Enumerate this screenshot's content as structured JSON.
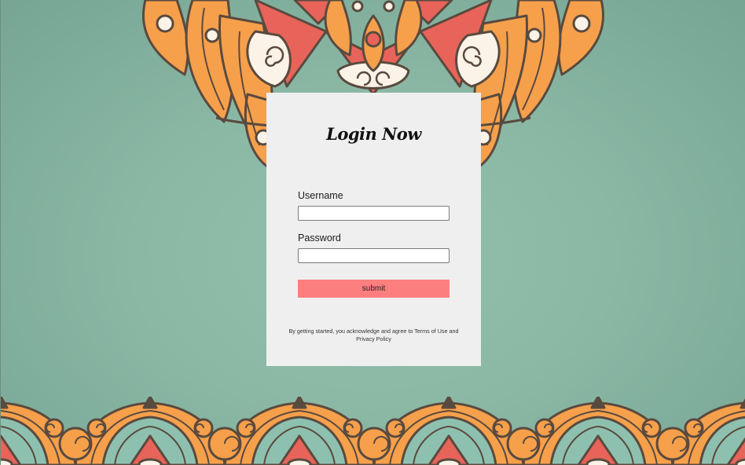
{
  "form": {
    "title": "Login Now",
    "username_label": "Username",
    "username_value": "",
    "password_label": "Password",
    "password_value": "",
    "submit_label": "submit",
    "terms_text": "By getting started, you acknowledge and agree to Terms of Use and Privacy Policy"
  },
  "colors": {
    "background": "#8bb8a5",
    "card": "#efefef",
    "submit_button": "#fc7e7e",
    "mandala_orange": "#f6a04c",
    "mandala_red": "#e8645a",
    "mandala_cream": "#fbf3e8",
    "mandala_teal": "#8ec0b0",
    "mandala_outline": "#5a4a3e"
  },
  "decorations": {
    "top": "mandala-ornament",
    "bottom": "mandala-border-pattern"
  }
}
